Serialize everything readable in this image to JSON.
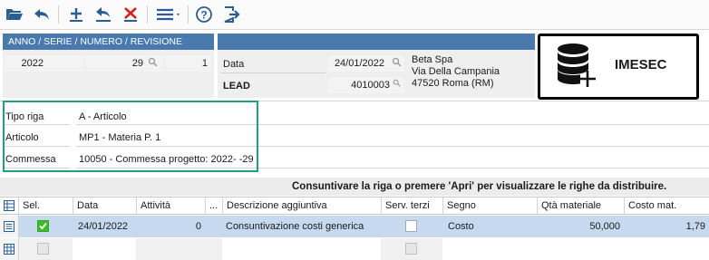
{
  "toolbar": {
    "buttons": [
      "open-icon",
      "undo-icon",
      "add-icon",
      "revert-icon",
      "delete-icon",
      "menu-icon",
      "help-icon",
      "exit-icon"
    ]
  },
  "header": {
    "section_title": "ANNO / SERIE / NUMERO / REVISIONE",
    "anno": "2022",
    "numero": "29",
    "revisione": "1",
    "data_label": "Data",
    "data_value": "24/01/2022",
    "lead_label": "LEAD",
    "lead_value": "4010003",
    "customer_name": "Beta Spa",
    "customer_address": "Via Della Campania",
    "customer_city": "47520 Roma (RM)"
  },
  "logo": {
    "text": "IMESEC"
  },
  "detail": {
    "tipo_riga_label": "Tipo riga",
    "tipo_riga_value": "A - Articolo",
    "articolo_label": "Articolo",
    "articolo_value": "MP1 - Materia P. 1",
    "commessa_label": "Commessa",
    "commessa_value": "10050 - Commessa progetto: 2022- -29"
  },
  "message": "Consuntivare la riga o premere 'Apri' per visualizzare le righe da distribuire.",
  "grid": {
    "columns": [
      "Sel.",
      "Data",
      "Attività",
      "...",
      "Descrizione aggiuntiva",
      "Serv. terzi",
      "Segno",
      "Qtà materiale",
      "Costo mat."
    ],
    "rows": [
      {
        "sel": true,
        "data": "24/01/2022",
        "attivita": "0",
        "descrizione": "Consuntivazione costi generica",
        "serv_terzi": false,
        "segno": "Costo",
        "qta": "50,000",
        "costo": "1,79"
      }
    ]
  },
  "colors": {
    "header_blue": "#4a79ad",
    "selected_row": "#c7d9ef",
    "green_frame": "#20a07f",
    "delete_red": "#d42020"
  }
}
